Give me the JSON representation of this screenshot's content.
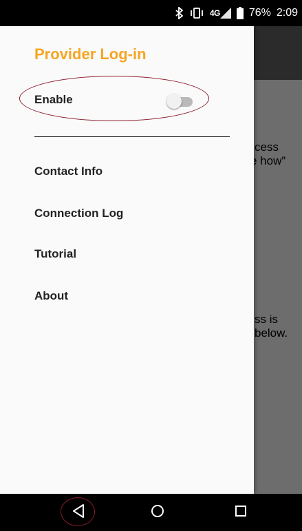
{
  "status_bar": {
    "network_label": "4G",
    "battery_percent": "76%",
    "time": "2:09",
    "icons": [
      "bluetooth-icon",
      "vibrate-icon",
      "signal-icon",
      "battery-icon"
    ]
  },
  "background_app": {
    "text_lines": [
      "cess",
      "e how”",
      "ss is",
      "below."
    ]
  },
  "drawer": {
    "title": "Provider Log-in",
    "title_color": "#f5a623",
    "enable_label": "Enable",
    "enable_toggle_on": false,
    "menu_items": [
      "Contact Info",
      "Connection Log",
      "Tutorial",
      "About"
    ]
  },
  "annotation_color": "#8b1a2b",
  "nav_bar": {
    "buttons": [
      "back-icon",
      "home-icon",
      "recents-icon"
    ]
  }
}
